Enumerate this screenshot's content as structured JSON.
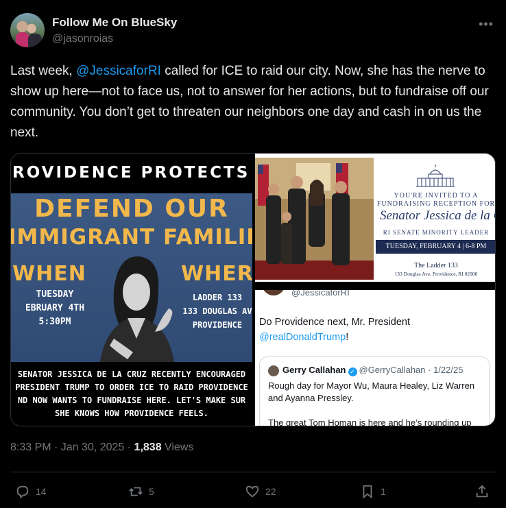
{
  "author": {
    "display_name": "Follow Me On BlueSky",
    "handle": "@jasonroias",
    "more_label": "•••"
  },
  "post": {
    "text_part1": "Last week, ",
    "mention": "@JessicaforRI",
    "text_part2": " called for ICE to raid our city. Now, she has the nerve to show up here—not to face us, not to answer for her actions, but to fundraise off our community. You don’t get to threaten our neighbors one day and cash in on us the next."
  },
  "flyer": {
    "top": "ROVIDENCE PROTECTS ITS OW",
    "headline1": "DEFEND OUR",
    "headline2": "IMMIGRANT FAMILIES",
    "when_label": "WHEN",
    "where_label": "WHERI",
    "when_lines": [
      "TUESDAY",
      "EBRUARY 4TH",
      "5:30PM"
    ],
    "where_lines": [
      "LADDER 133",
      "133 DOUGLAS AV",
      "PROVIDENCE"
    ],
    "bottom_lines": [
      "SENATOR JESSICA DE LA CRUZ RECENTLY ENCOURAGED",
      "PRESIDENT TRUMP TO ORDER ICE TO RAID PROVIDENCE",
      "ND NOW WANTS TO FUNDRAISE HERE. LET'S MAKE SUR",
      "SHE KNOWS HOW PROVIDENCE FEELS."
    ]
  },
  "invitation": {
    "line1": "YOU'RE INVITED TO A",
    "line2": "FUNDRAISING RECEPTION FOR",
    "name": "Senator Jessica de la Cruz",
    "role": "RI SENATE MINORITY LEADER",
    "date_bar": "TUESDAY, FEBRUARY 4  |  6-8 PM",
    "venue": "The Ladder 133",
    "address": "133 Douglas Ave, Providence, RI 02908"
  },
  "screenshot": {
    "handle": "@JessicaforRI",
    "text_line1": "Do Providence next, Mr. President",
    "mention": "@realDonaldTrump",
    "text_suffix": "!",
    "quote": {
      "name": "Gerry Callahan",
      "verified_glyph": "✓",
      "meta": "@GerryCallahan · 1/22/25",
      "text1": "Rough day for Mayor Wu, Maura Healey, Liz Warren and Ayanna Pressley.",
      "text2": "The great Tom Homan is here and he’s rounding up"
    }
  },
  "meta": {
    "time": "8:33 PM · Jan 30, 2025 · ",
    "views_count": "1,838",
    "views_label": " Views"
  },
  "actions": {
    "replies": "14",
    "reposts": "5",
    "likes": "22",
    "bookmarks": "1"
  },
  "colors": {
    "background": "#000000",
    "accent": "#1d9bf0",
    "muted": "#71767b",
    "flyer_gold": "#f2b84b",
    "flyer_blue": "#3d5a84",
    "invite_navy": "#1e2b52"
  }
}
